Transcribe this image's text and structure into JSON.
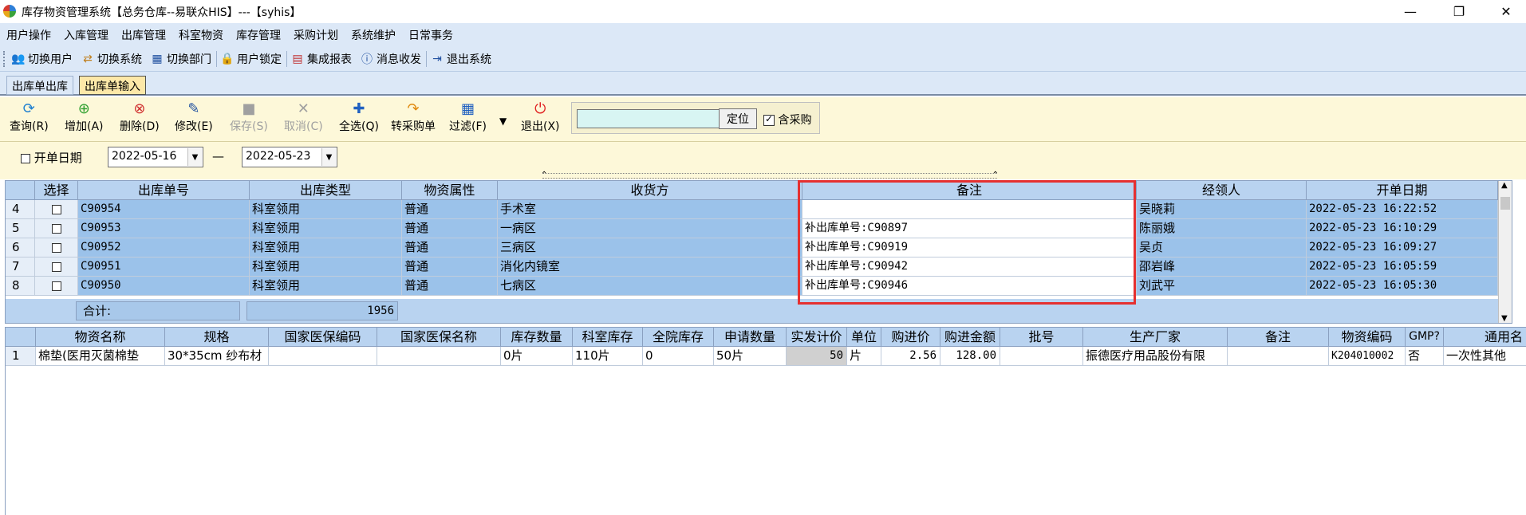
{
  "window": {
    "title": "库存物资管理系统【总务仓库--易联众HIS】---【syhis】"
  },
  "menu": [
    "用户操作",
    "入库管理",
    "出库管理",
    "科室物资",
    "库存管理",
    "采购计划",
    "系统维护",
    "日常事务"
  ],
  "toolbar": {
    "switch_user": "切换用户",
    "switch_system": "切换系统",
    "switch_dept": "切换部门",
    "lock_user": "用户锁定",
    "integrated_report": "集成报表",
    "messages": "消息收发",
    "exit_system": "退出系统"
  },
  "tabs": {
    "outbound_list": "出库单出库",
    "outbound_input": "出库单输入"
  },
  "actions": {
    "query": "查询(R)",
    "add": "增加(A)",
    "delete": "删除(D)",
    "edit": "修改(E)",
    "save": "保存(S)",
    "cancel": "取消(C)",
    "select_all": "全选(Q)",
    "to_purchase": "转采购单",
    "filter": "过滤(F)",
    "exit": "退出(X)",
    "locate": "定位",
    "include_purchase": "含采购"
  },
  "date_filter": {
    "label": "开单日期",
    "from": "2022-05-16",
    "to": "2022-05-23",
    "separator": "—"
  },
  "outbound_grid": {
    "headers": [
      "选择",
      "出库单号",
      "出库类型",
      "物资属性",
      "收货方",
      "备注",
      "经领人",
      "开单日期"
    ],
    "rows": [
      {
        "idx": "4",
        "no": "C90954",
        "type": "科室领用",
        "attr": "普通",
        "receiver": "手术室",
        "remark": "",
        "handler": "吴晓莉",
        "date": "2022-05-23 16:22:52"
      },
      {
        "idx": "5",
        "no": "C90953",
        "type": "科室领用",
        "attr": "普通",
        "receiver": "一病区",
        "remark": "补出库单号:C90897",
        "handler": "陈丽娥",
        "date": "2022-05-23 16:10:29"
      },
      {
        "idx": "6",
        "no": "C90952",
        "type": "科室领用",
        "attr": "普通",
        "receiver": "三病区",
        "remark": "补出库单号:C90919",
        "handler": "吴贞",
        "date": "2022-05-23 16:09:27"
      },
      {
        "idx": "7",
        "no": "C90951",
        "type": "科室领用",
        "attr": "普通",
        "receiver": "消化内镜室",
        "remark": "补出库单号:C90942",
        "handler": "邵岩峰",
        "date": "2022-05-23 16:05:59"
      },
      {
        "idx": "8",
        "no": "C90950",
        "type": "科室领用",
        "attr": "普通",
        "receiver": "七病区",
        "remark": "补出库单号:C90946",
        "handler": "刘武平",
        "date": "2022-05-23 16:05:30"
      }
    ],
    "total_label": "合计:",
    "total_value": "1956"
  },
  "detail_grid": {
    "headers": [
      "物资名称",
      "规格",
      "国家医保编码",
      "国家医保名称",
      "库存数量",
      "科室库存",
      "全院库存",
      "申请数量",
      "实发计价",
      "单位",
      "购进价",
      "购进金额",
      "批号",
      "生产厂家",
      "备注",
      "物资编码",
      "GMP?",
      "通用名"
    ],
    "rows": [
      {
        "idx": "1",
        "name": "棉垫(医用灭菌棉垫",
        "spec": "30*35cm  纱布材",
        "nhsa_code": "",
        "nhsa_name": "",
        "stock": "0片",
        "dept_stock": "110片",
        "hosp_stock": "0",
        "apply_qty": "50片",
        "actual": "50",
        "unit": "片",
        "price": "2.56",
        "amount": "128.00",
        "batch": "",
        "maker": "振德医疗用品股份有限",
        "remark": "",
        "code": "K204010002",
        "gmp": "否",
        "generic": "一次性其他"
      }
    ]
  }
}
